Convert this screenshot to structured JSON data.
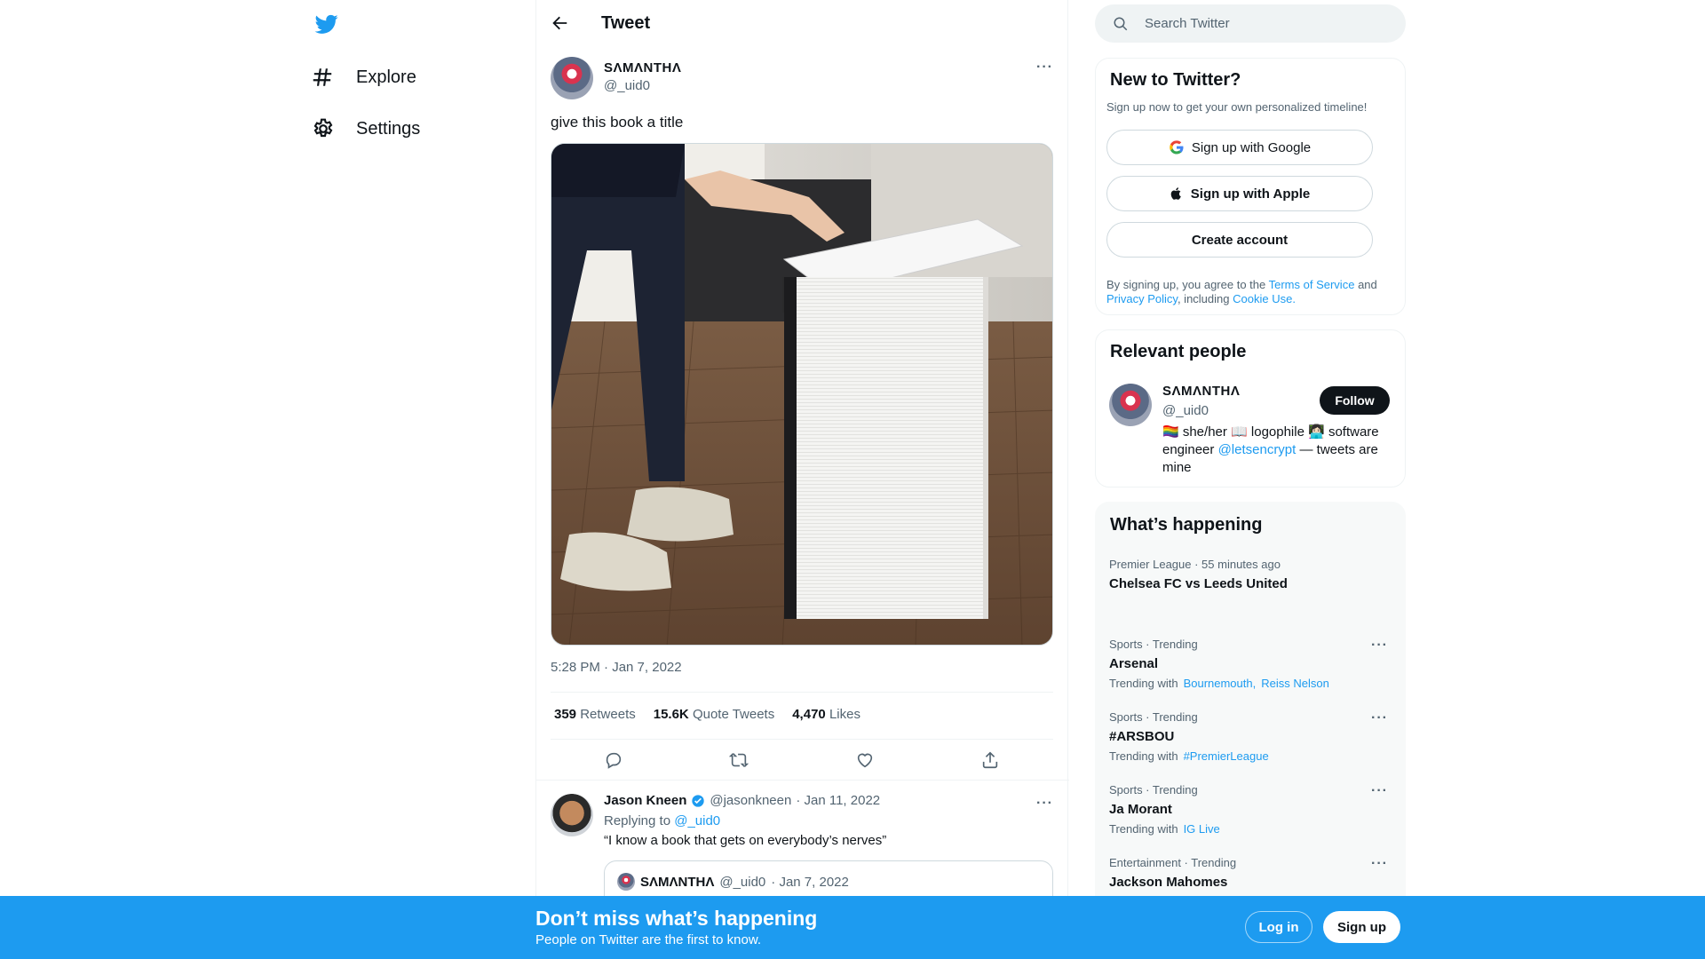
{
  "nav": {
    "explore_label": "Explore",
    "settings_label": "Settings"
  },
  "header": {
    "title": "Tweet"
  },
  "tweet": {
    "author_name": "SΛMΛNTHΛ",
    "author_handle": "@_uid0",
    "text": "give this book a title",
    "timestamp": "5:28 PM · Jan 7, 2022",
    "stats": {
      "retweets_count": "359",
      "retweets_label": "Retweets",
      "quotes_count": "15.6K",
      "quotes_label": "Quote Tweets",
      "likes_count": "4,470",
      "likes_label": "Likes"
    }
  },
  "reply": {
    "author_name": "Jason Kneen",
    "author_handle": "@jasonkneen",
    "date": "· Jan 11, 2022",
    "replying_prefix": "Replying to",
    "replying_to": "@_uid0",
    "text": "“I know a book that gets on everybody’s nerves”",
    "quote": {
      "author_name": "SΛMΛNTHΛ",
      "author_handle": "@_uid0",
      "date": "· Jan 7, 2022"
    }
  },
  "search": {
    "placeholder": "Search Twitter"
  },
  "signup_card": {
    "title": "New to Twitter?",
    "subtitle": "Sign up now to get your own personalized timeline!",
    "google_label": "Sign up with Google",
    "apple_label": "Sign up with Apple",
    "create_label": "Create account",
    "terms_prefix": "By signing up, you agree to the",
    "terms_link": "Terms of Service",
    "terms_and": "and",
    "privacy_link": "Privacy Policy",
    "terms_including": ", including",
    "cookie_link": "Cookie Use."
  },
  "relevant": {
    "title": "Relevant people",
    "name": "SΛMΛNTHΛ",
    "handle": "@_uid0",
    "follow_label": "Follow",
    "bio_prefix": "🏳️‍🌈 she/her 📖 logophile 👩🏻‍💻 software engineer",
    "bio_link": "@letsencrypt",
    "bio_suffix": "— tweets are mine"
  },
  "happening": {
    "title": "What’s happening",
    "items": [
      {
        "meta": "Premier League · 55 minutes ago",
        "topic": "Chelsea FC vs Leeds United",
        "with_label": "",
        "with_links": []
      },
      {
        "meta": "Sports · Trending",
        "topic": "Arsenal",
        "with_label": "Trending with",
        "with_links": [
          "Bournemouth",
          "Reiss Nelson"
        ]
      },
      {
        "meta": "Sports · Trending",
        "topic": "#ARSBOU",
        "with_label": "Trending with",
        "with_links": [
          "#PremierLeague"
        ]
      },
      {
        "meta": "Sports · Trending",
        "topic": "Ja Morant",
        "with_label": "Trending with",
        "with_links": [
          "IG Live"
        ]
      },
      {
        "meta": "Entertainment · Trending",
        "topic": "Jackson Mahomes",
        "with_label": "",
        "with_links": []
      }
    ]
  },
  "bottom_bar": {
    "title": "Don’t miss what’s happening",
    "subtitle": "People on Twitter are the first to know.",
    "login_label": "Log in",
    "signup_label": "Sign up"
  },
  "colors": {
    "accent": "#1d9bf0",
    "text": "#0f1419",
    "muted": "#536471"
  },
  "icons": [
    "twitter-logo-icon",
    "hashtag-icon",
    "gear-icon",
    "back-arrow-icon",
    "more-icon",
    "reply-icon",
    "retweet-icon",
    "like-icon",
    "share-icon",
    "search-icon",
    "google-icon",
    "apple-icon",
    "verified-icon"
  ]
}
